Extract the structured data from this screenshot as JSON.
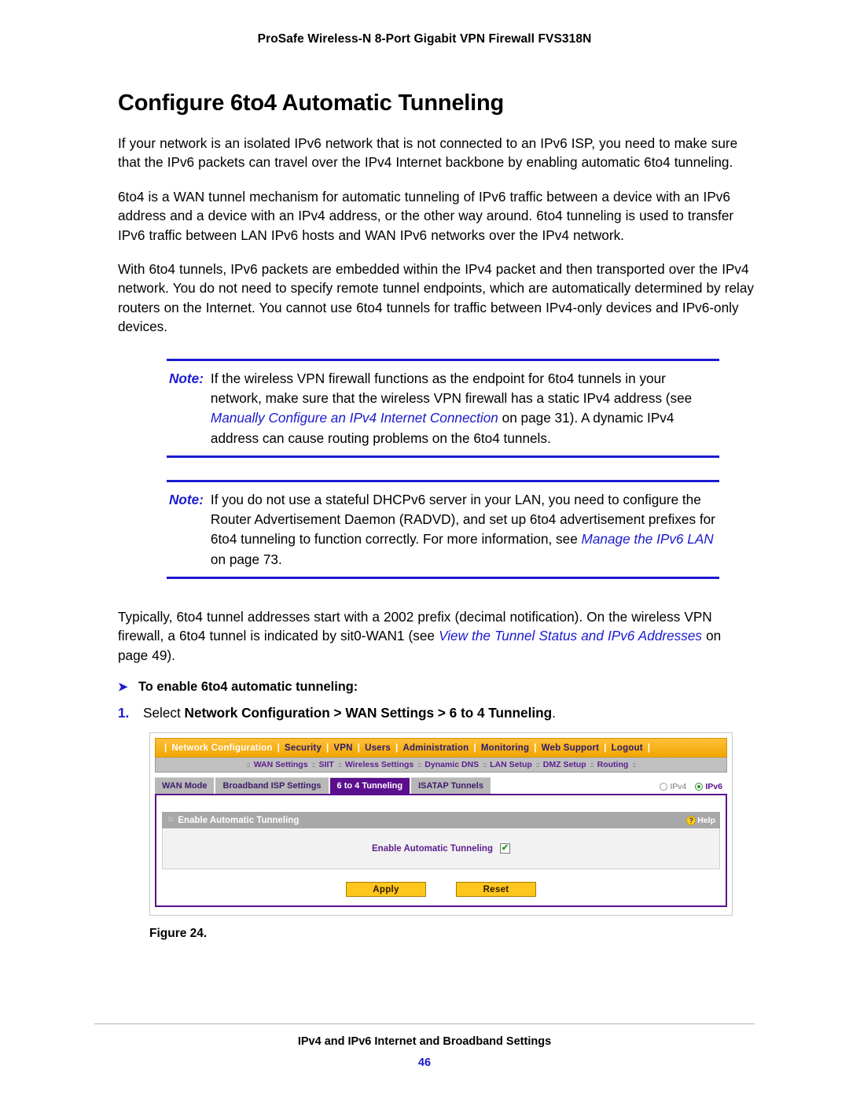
{
  "header": {
    "title": "ProSafe Wireless-N 8-Port Gigabit VPN Firewall FVS318N"
  },
  "doc": {
    "title": "Configure 6to4 Automatic Tunneling",
    "paragraphs": [
      "If your network is an isolated IPv6 network that is not connected to an IPv6 ISP, you need to make sure that the IPv6 packets can travel over the IPv4 Internet backbone by enabling automatic 6to4 tunneling.",
      "6to4 is a WAN tunnel mechanism for automatic tunneling of IPv6 traffic between a device with an IPv6 address and a device with an IPv4 address, or the other way around. 6to4 tunneling is used to transfer IPv6 traffic between LAN IPv6 hosts and WAN IPv6 networks over the IPv4 network.",
      "With 6to4 tunnels, IPv6 packets are embedded within the IPv4 packet and then transported over the IPv4 network. You do not need to specify remote tunnel endpoints, which are automatically determined by relay routers on the Internet. You cannot use 6to4 tunnels for traffic between IPv4-only devices and IPv6-only devices."
    ]
  },
  "notes": [
    {
      "label": "Note:",
      "text_before": "If the wireless VPN firewall functions as the endpoint for 6to4 tunnels in your network, make sure that the wireless VPN firewall has a static IPv4 address (see ",
      "xref": "Manually Configure an IPv4 Internet Connection",
      "text_after": " on page 31). A dynamic IPv4 address can cause routing problems on the 6to4 tunnels."
    },
    {
      "label": "Note:",
      "text_before": "If you do not use a stateful DHCPv6 server in your LAN, you need to configure the Router Advertisement Daemon (RADVD), and set up 6to4 advertisement prefixes for 6to4 tunneling to function correctly. For more information, see ",
      "xref": "Manage the IPv6 LAN",
      "text_after": " on page 73."
    }
  ],
  "closing_para": {
    "text_before": "Typically, 6to4 tunnel addresses start with a 2002 prefix (decimal notification). On the wireless VPN firewall, a 6to4 tunnel is indicated by sit0-WAN1 (see ",
    "xref": "View the Tunnel Status and IPv6 Addresses",
    "text_after": " on page 49)."
  },
  "procedure": {
    "arrow": "➤",
    "heading": "To enable 6to4 automatic tunneling:",
    "step_number": "1.",
    "step_prefix": "Select ",
    "step_bold": "Network Configuration > WAN Settings > 6 to 4 Tunneling",
    "step_suffix": "."
  },
  "screenshot": {
    "menu": {
      "items": [
        {
          "label": "Network Configuration",
          "active": true
        },
        {
          "label": "Security",
          "active": false
        },
        {
          "label": "VPN",
          "active": false
        },
        {
          "label": "Users",
          "active": false
        },
        {
          "label": "Administration",
          "active": false
        },
        {
          "label": "Monitoring",
          "active": false
        },
        {
          "label": "Web Support",
          "active": false
        },
        {
          "label": "Logout",
          "active": false
        }
      ],
      "separator": "|"
    },
    "submenu": {
      "dots": "::",
      "items": [
        "WAN Settings",
        "SIIT",
        "Wireless Settings",
        "Dynamic DNS",
        "LAN Setup",
        "DMZ Setup",
        "Routing"
      ]
    },
    "tabs": [
      {
        "label": "WAN Mode",
        "active": false
      },
      {
        "label": "Broadband ISP Settings",
        "active": false
      },
      {
        "label": "6 to 4 Tunneling",
        "active": true
      },
      {
        "label": "ISATAP Tunnels",
        "active": false
      }
    ],
    "ip_mode": [
      {
        "label": "IPv4",
        "selected": false
      },
      {
        "label": "IPv6",
        "selected": true
      }
    ],
    "section": {
      "grip": "⁙",
      "title": "Enable Automatic Tunneling",
      "help_icon": "?",
      "help_label": "Help"
    },
    "field": {
      "label": "Enable Automatic Tunneling",
      "checked": true,
      "check_glyph": "✔"
    },
    "buttons": [
      {
        "label": "Apply"
      },
      {
        "label": "Reset"
      }
    ]
  },
  "figure": {
    "caption": "Figure 24."
  },
  "footer": {
    "title": "IPv4 and IPv6 Internet and Broadband Settings",
    "page": "46"
  },
  "colors": {
    "link_blue": "#1a1ad0",
    "menu_orange": "#f0a500",
    "tab_purple": "#5b0f8e",
    "button_gold": "#ffc61e",
    "check_green": "#1f9b1f"
  }
}
